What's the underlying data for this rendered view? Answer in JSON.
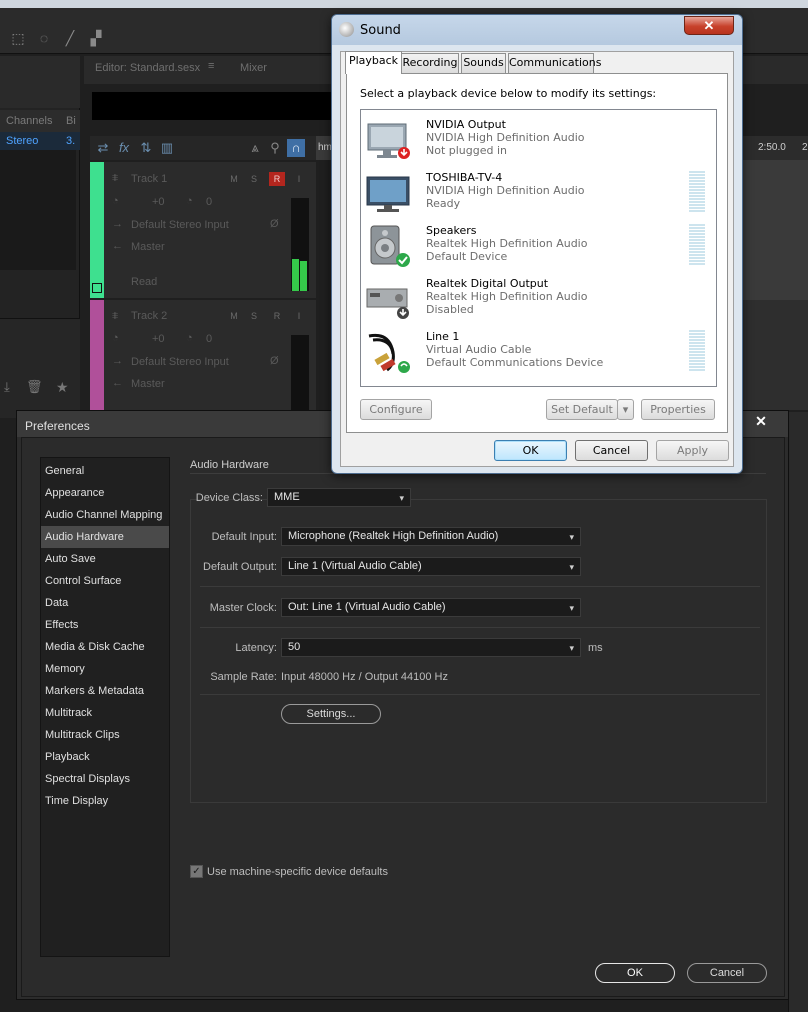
{
  "daw": {
    "editor_tab": "Editor: Standard.sesx",
    "mixer_tab": "Mixer",
    "channels_header": "Channels",
    "bi_header": "Bi",
    "stereo_row": "Stereo",
    "stereo_val": "3.",
    "ruler_left": "hm",
    "ruler_right": "2:50.0",
    "ruler_right2": "2",
    "tracks": [
      {
        "name": "Track 1",
        "vol": "+0",
        "pan": "0",
        "input": "Default Stereo Input",
        "output": "Master",
        "mode": "Read",
        "m": "M",
        "s": "S",
        "r": "R",
        "i": "I"
      },
      {
        "name": "Track 2",
        "vol": "+0",
        "pan": "0",
        "input": "Default Stereo Input",
        "output": "Master",
        "m": "M",
        "s": "S",
        "r": "R",
        "i": "I"
      }
    ]
  },
  "sound_dialog": {
    "title": "Sound",
    "close": "✕",
    "tabs": [
      "Playback",
      "Recording",
      "Sounds",
      "Communications"
    ],
    "instruction": "Select a playback device below to modify its settings:",
    "devices": [
      {
        "name": "NVIDIA Output",
        "driver": "NVIDIA High Definition Audio",
        "status": "Not plugged in"
      },
      {
        "name": "TOSHIBA-TV-4",
        "driver": "NVIDIA High Definition Audio",
        "status": "Ready"
      },
      {
        "name": "Speakers",
        "driver": "Realtek High Definition Audio",
        "status": "Default Device"
      },
      {
        "name": "Realtek Digital Output",
        "driver": "Realtek High Definition Audio",
        "status": "Disabled"
      },
      {
        "name": "Line 1",
        "driver": "Virtual Audio Cable",
        "status": "Default Communications Device"
      }
    ],
    "buttons": {
      "configure": "Configure",
      "set_default": "Set Default",
      "properties": "Properties",
      "ok": "OK",
      "cancel": "Cancel",
      "apply": "Apply"
    }
  },
  "preferences": {
    "title": "Preferences",
    "close": "✕",
    "nav": [
      "General",
      "Appearance",
      "Audio Channel Mapping",
      "Audio Hardware",
      "Auto Save",
      "Control Surface",
      "Data",
      "Effects",
      "Media & Disk Cache",
      "Memory",
      "Markers & Metadata",
      "Multitrack",
      "Multitrack Clips",
      "Playback",
      "Spectral Displays",
      "Time Display"
    ],
    "selected_nav": "Audio Hardware",
    "section_title": "Audio Hardware",
    "device_class_label": "Device Class:",
    "device_class": "MME",
    "default_input_label": "Default Input:",
    "default_input": "Microphone (Realtek High Definition Audio)",
    "default_output_label": "Default Output:",
    "default_output": "Line 1 (Virtual Audio Cable)",
    "master_clock_label": "Master Clock:",
    "master_clock": "Out: Line 1 (Virtual Audio Cable)",
    "latency_label": "Latency:",
    "latency": "50",
    "latency_unit": "ms",
    "sample_rate_label": "Sample Rate:",
    "sample_rate": "Input 48000 Hz / Output 44100 Hz",
    "settings_button": "Settings...",
    "machine_defaults_label": "Use machine-specific device defaults",
    "machine_defaults_checked": true,
    "ok": "OK",
    "cancel": "Cancel"
  },
  "colors": {
    "track1": "#3ee08f",
    "track2": "#b0509a",
    "record": "#b3261e",
    "meter": "#35c94a"
  }
}
